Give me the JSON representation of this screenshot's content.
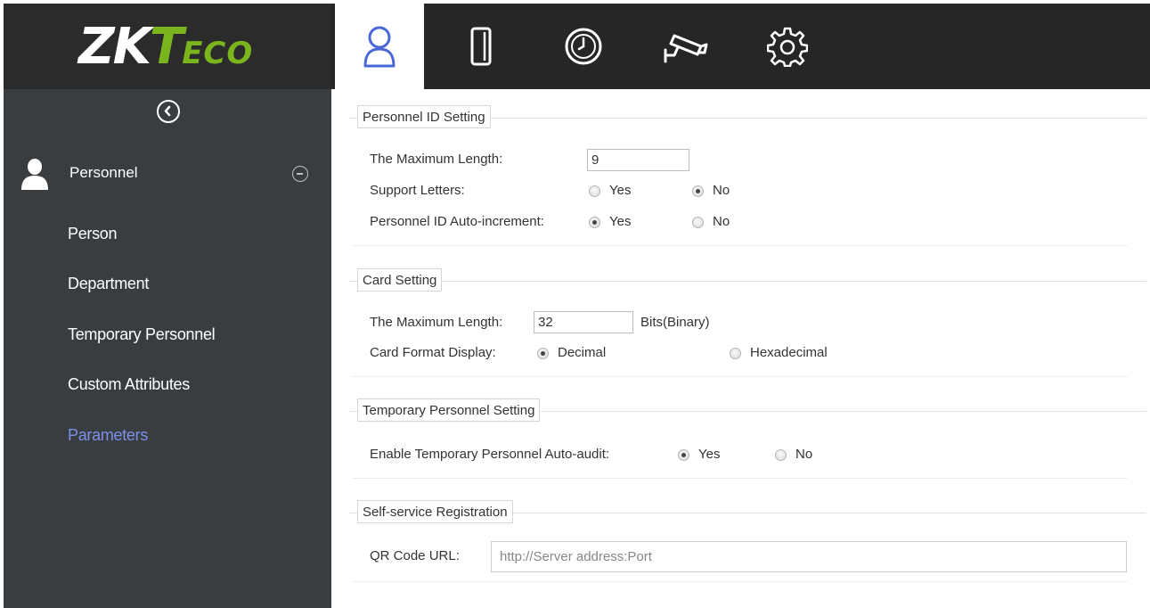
{
  "app": {
    "logo": {
      "zk": "ZK",
      "t": "T",
      "eco": "ECO"
    },
    "brand_color": "#7ab51d"
  },
  "sidebar": {
    "collapse_icon": "chevron-left-circle-icon",
    "section": {
      "label": "Personnel",
      "icon": "person-icon",
      "toggle_icon": "minus-circle-icon"
    },
    "items": [
      {
        "label": "Person",
        "active": false
      },
      {
        "label": "Department",
        "active": false
      },
      {
        "label": "Temporary Personnel",
        "active": false
      },
      {
        "label": "Custom Attributes",
        "active": false
      },
      {
        "label": "Parameters",
        "active": true
      }
    ],
    "active_color": "#7b8fe8"
  },
  "topbar": {
    "tabs": [
      {
        "icon": "personnel-icon",
        "active": true
      },
      {
        "icon": "door-icon",
        "active": false
      },
      {
        "icon": "clock-icon",
        "active": false
      },
      {
        "icon": "camera-icon",
        "active": false
      },
      {
        "icon": "settings-icon",
        "active": false
      }
    ]
  },
  "personnel_id": {
    "title": "Personnel ID Setting",
    "max_length_label": "The Maximum Length:",
    "max_length_value": "9",
    "support_letters_label": "Support Letters:",
    "support_letters_yes": "Yes",
    "support_letters_no": "No",
    "support_letters_selected": "No",
    "auto_increment_label": "Personnel ID Auto-increment:",
    "auto_increment_yes": "Yes",
    "auto_increment_no": "No",
    "auto_increment_selected": "Yes"
  },
  "card": {
    "title": "Card Setting",
    "max_length_label": "The Maximum Length:",
    "max_length_value": "32",
    "bits_label": "Bits(Binary)",
    "format_label": "Card Format Display:",
    "format_decimal": "Decimal",
    "format_hex": "Hexadecimal",
    "format_selected": "Decimal"
  },
  "temporary": {
    "title": "Temporary Personnel Setting",
    "auto_audit_label": "Enable Temporary Personnel Auto-audit:",
    "yes": "Yes",
    "no": "No",
    "selected": "Yes"
  },
  "self_service": {
    "title": "Self-service Registration",
    "qr_label": "QR Code URL:",
    "qr_placeholder": "http://Server address:Port"
  }
}
